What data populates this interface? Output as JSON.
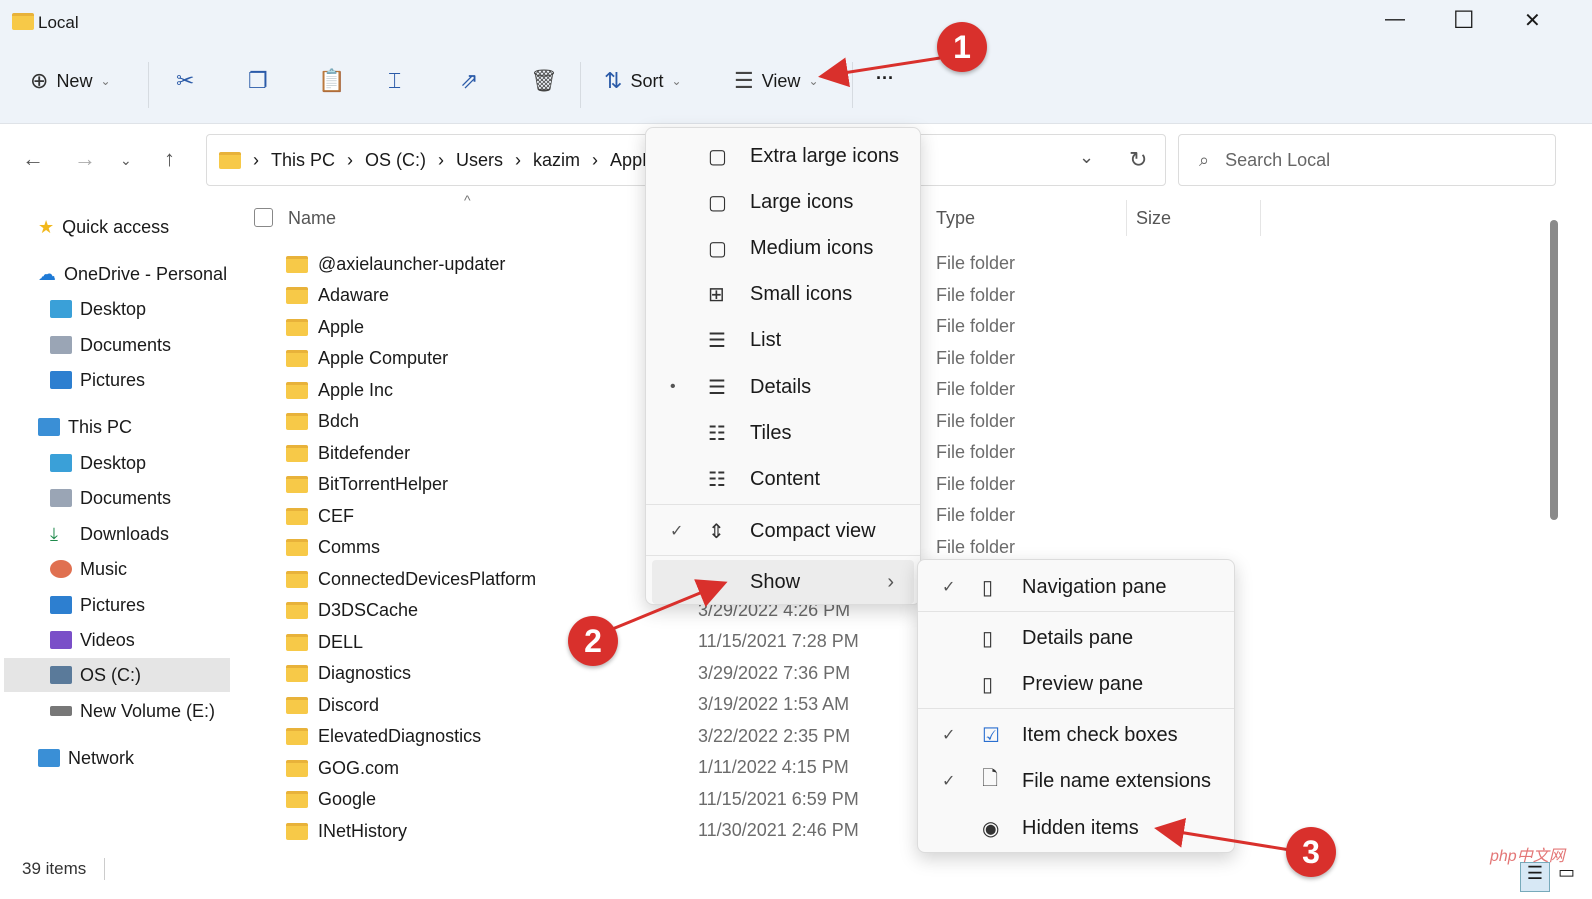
{
  "window": {
    "title": "Local",
    "min": "—",
    "max": "☐",
    "close": "✕"
  },
  "toolbar": {
    "new": "New",
    "sort": "Sort",
    "view": "View",
    "more": "···"
  },
  "address": {
    "crumbs": [
      "This PC",
      "OS (C:)",
      "Users",
      "kazim",
      "AppD"
    ],
    "search_placeholder": "Search Local"
  },
  "sidebar": {
    "items": [
      "Quick access",
      "OneDrive - Personal",
      "Desktop",
      "Documents",
      "Pictures",
      "This PC",
      "Desktop",
      "Documents",
      "Downloads",
      "Music",
      "Pictures",
      "Videos",
      "OS (C:)",
      "New Volume (E:)",
      "Network"
    ]
  },
  "columns": {
    "name": "Name",
    "type": "Type",
    "size": "Size"
  },
  "files": [
    {
      "name": "@axielauncher-updater",
      "date": "",
      "type": "File folder"
    },
    {
      "name": "Adaware",
      "date": "",
      "type": "File folder"
    },
    {
      "name": "Apple",
      "date": "",
      "type": "File folder"
    },
    {
      "name": "Apple Computer",
      "date": "",
      "type": "File folder"
    },
    {
      "name": "Apple Inc",
      "date": "",
      "type": "File folder"
    },
    {
      "name": "Bdch",
      "date": "",
      "type": "File folder"
    },
    {
      "name": "Bitdefender",
      "date": "",
      "type": "File folder"
    },
    {
      "name": "BitTorrentHelper",
      "date": "",
      "type": "File folder"
    },
    {
      "name": "CEF",
      "date": "",
      "type": "File folder"
    },
    {
      "name": "Comms",
      "date": "",
      "type": "File folder"
    },
    {
      "name": "ConnectedDevicesPlatform",
      "date": "",
      "type": ""
    },
    {
      "name": "D3DSCache",
      "date": "3/29/2022 4:26 PM",
      "type": ""
    },
    {
      "name": "DELL",
      "date": "11/15/2021 7:28 PM",
      "type": ""
    },
    {
      "name": "Diagnostics",
      "date": "3/29/2022 7:36 PM",
      "type": ""
    },
    {
      "name": "Discord",
      "date": "3/19/2022 1:53 AM",
      "type": ""
    },
    {
      "name": "ElevatedDiagnostics",
      "date": "3/22/2022 2:35 PM",
      "type": ""
    },
    {
      "name": "GOG.com",
      "date": "1/11/2022 4:15 PM",
      "type": ""
    },
    {
      "name": "Google",
      "date": "11/15/2021 6:59 PM",
      "type": ""
    },
    {
      "name": "INetHistory",
      "date": "11/30/2021 2:46 PM",
      "type": ""
    }
  ],
  "status": {
    "count": "39 items"
  },
  "view_menu": [
    {
      "label": "Extra large icons",
      "icon": "▢",
      "mark": ""
    },
    {
      "label": "Large icons",
      "icon": "▢",
      "mark": ""
    },
    {
      "label": "Medium icons",
      "icon": "▢",
      "mark": ""
    },
    {
      "label": "Small icons",
      "icon": "⊞",
      "mark": ""
    },
    {
      "label": "List",
      "icon": "☰",
      "mark": ""
    },
    {
      "label": "Details",
      "icon": "☰",
      "mark": "•"
    },
    {
      "label": "Tiles",
      "icon": "☷",
      "mark": ""
    },
    {
      "label": "Content",
      "icon": "☷",
      "mark": ""
    },
    {
      "label": "Compact view",
      "icon": "⇕",
      "mark": "✓"
    },
    {
      "label": "Show",
      "icon": "",
      "mark": ""
    }
  ],
  "show_menu": [
    {
      "label": "Navigation pane",
      "icon": "▯",
      "mark": "✓"
    },
    {
      "label": "Details pane",
      "icon": "▯",
      "mark": ""
    },
    {
      "label": "Preview pane",
      "icon": "▯",
      "mark": ""
    },
    {
      "label": "Item check boxes",
      "icon": "☑",
      "mark": "✓"
    },
    {
      "label": "File name extensions",
      "icon": "🗋",
      "mark": "✓"
    },
    {
      "label": "Hidden items",
      "icon": "◉",
      "mark": ""
    }
  ],
  "annotations": [
    "1",
    "2",
    "3"
  ],
  "watermark": "php中文网",
  "colors": {
    "accent": "#2a5aa8",
    "annotation": "#d9302c",
    "toolbar_bg": "#eef3f9"
  }
}
